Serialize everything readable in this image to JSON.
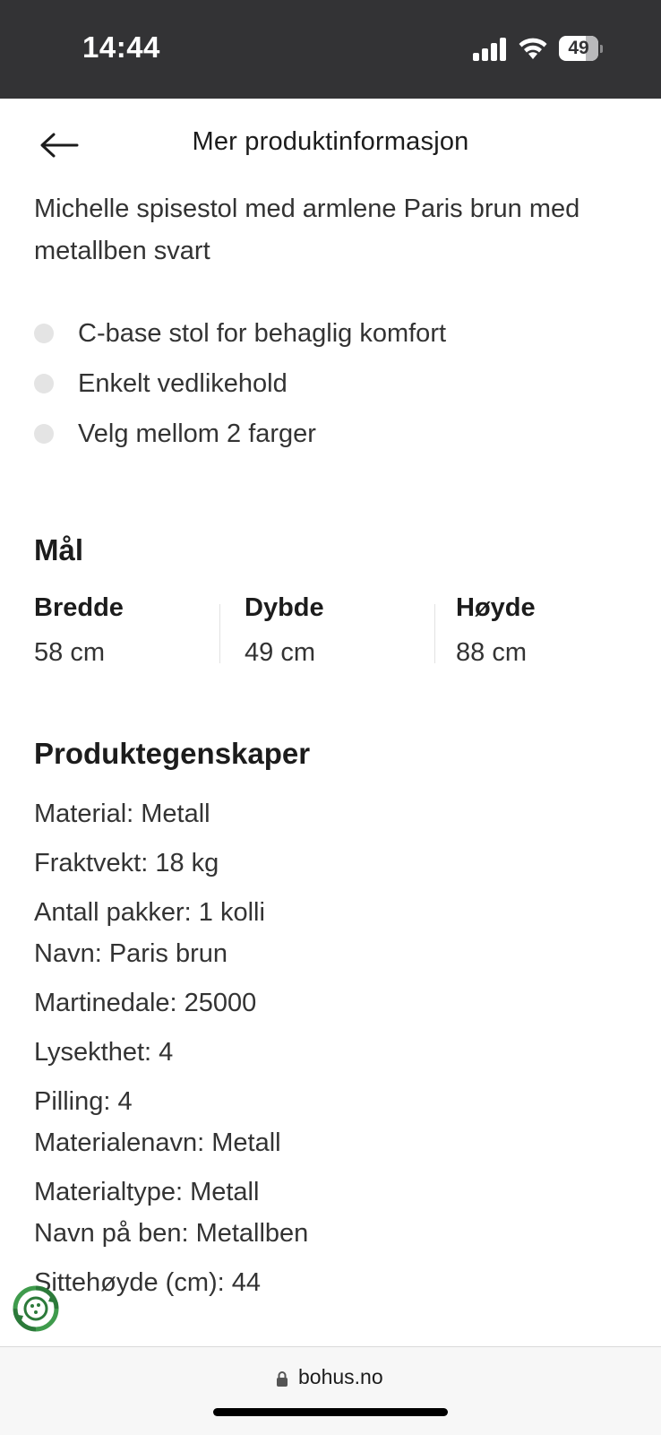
{
  "status_bar": {
    "time": "14:44",
    "battery_level": "49"
  },
  "header": {
    "title": "Mer produktinformasjon"
  },
  "product": {
    "name": "Michelle spisestol med armlene Paris brun med metallben svart",
    "features": [
      "C-base stol for behaglig komfort",
      "Enkelt vedlikehold",
      "Velg mellom 2 farger"
    ]
  },
  "dimensions": {
    "title": "Mål",
    "items": [
      {
        "label": "Bredde",
        "value": "58 cm"
      },
      {
        "label": "Dybde",
        "value": "49 cm"
      },
      {
        "label": "Høyde",
        "value": "88 cm"
      }
    ]
  },
  "properties": {
    "title": "Produktegenskaper",
    "items": [
      "Material: Metall",
      "Fraktvekt: 18 kg",
      "Antall pakker: 1 kolli",
      "Navn: Paris brun",
      "Martinedale: 25000",
      "Lysekthet: 4",
      "Pilling: 4",
      "Materialenavn: Metall",
      "Materialtype: Metall",
      "Navn på ben: Metallben",
      "Sittehøyde (cm): 44"
    ]
  },
  "browser": {
    "url": "bohus.no"
  }
}
